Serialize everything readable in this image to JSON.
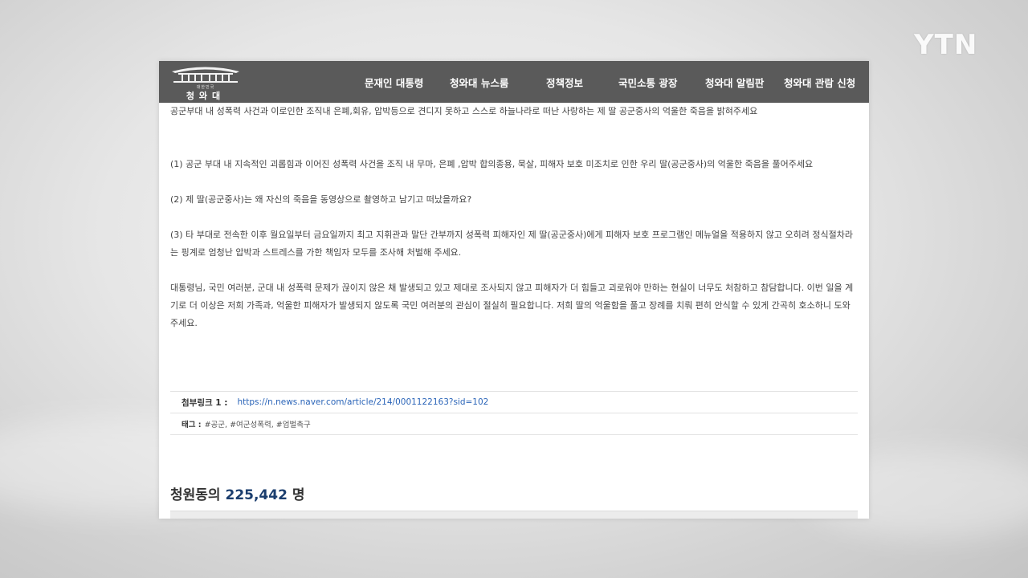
{
  "broadcaster": "YTN",
  "site": {
    "logo_sub": "대한민국",
    "logo_title": "청와대"
  },
  "nav": [
    "문재인 대통령",
    "청와대 뉴스룸",
    "정책정보",
    "국민소통 광장",
    "청와대 알림판",
    "청와대 관람 신청"
  ],
  "petition": {
    "intro": "공군부대 내 성폭력 사건과 이로인한 조직내 은폐,회유, 압박등으로 견디지 못하고 스스로 하늘나라로 떠난 사랑하는 제 딸 공군중사의 억울한 죽음을 밝혀주세요",
    "points": [
      "(1) 공군 부대 내 지속적인 괴롭힘과 이어진 성폭력 사건을 조직 내 무마, 은폐 ,압박 합의종용, 묵살, 피해자 보호 미조치로  인한 우리 딸(공군중사)의 억울한 죽음을 풀어주세요",
      "(2) 제 딸(공군중사)는 왜 자신의 죽음을 동영상으로 촬영하고 남기고 떠났을까요?",
      "(3) 타 부대로 전속한 이후 월요일부터 금요일까지 최고 지휘관과 말단 간부까지 성폭력 피해자인 제 딸(공군중사)에게 피해자 보호 프로그램인  메뉴얼을 적용하지 않고 오히려 정식절차라는 핑계로 엄청난 압박과 스트레스를 가한 책임자 모두를 조사해  처벌해 주세요."
    ],
    "closing": "대통령님, 국민 여러분, 군대 내 성폭력 문제가 끊이지 않은 채 발생되고 있고 제대로 조사되지 않고 피해자가 더 힘들고 괴로워야 만하는 현실이 너무도 처참하고 참담합니다. 이번 일을 계기로 더 이상은 저희 가족과, 억울한 피해자가 발생되지 않도록 국민 여러분의 관심이 절실히 필요합니다. 저희 딸의 억울함을 풀고 장례를 치뤄 편히 안식할 수 있게 간곡히 호소하니 도와주세요.",
    "attachment_label": "첨부링크 1 :",
    "attachment_url": "https://n.news.naver.com/article/214/0001122163?sid=102",
    "tags_label": "태그 :",
    "tags": "#공군, #여군성폭력, #엄벌촉구",
    "signers_prefix": "청원동의",
    "signers_count": "225,442",
    "signers_unit": "명"
  },
  "colors": {
    "nav_bg": "#5a5a5a",
    "link": "#2a64b8",
    "count": "#1b3e6e"
  }
}
